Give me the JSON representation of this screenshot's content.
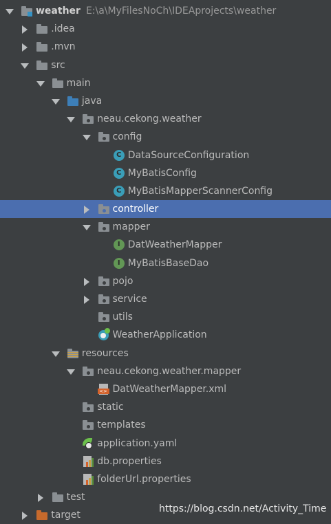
{
  "project": {
    "name": "weather",
    "path": "E:\\a\\MyFilesNoCh\\IDEAprojects\\weather"
  },
  "tree": [
    {
      "level": 0,
      "arrow": "down",
      "icon": "module-folder-icon",
      "label": "weather",
      "bold": true,
      "path": "E:\\a\\MyFilesNoCh\\IDEAprojects\\weather"
    },
    {
      "level": 1,
      "arrow": "right",
      "icon": "folder-icon",
      "label": ".idea"
    },
    {
      "level": 1,
      "arrow": "right",
      "icon": "folder-icon",
      "label": ".mvn"
    },
    {
      "level": 1,
      "arrow": "down",
      "icon": "folder-icon",
      "label": "src"
    },
    {
      "level": 2,
      "arrow": "down",
      "icon": "folder-icon",
      "label": "main"
    },
    {
      "level": 3,
      "arrow": "down",
      "icon": "source-folder-icon",
      "label": "java"
    },
    {
      "level": 4,
      "arrow": "down",
      "icon": "package-icon",
      "label": "neau.cekong.weather"
    },
    {
      "level": 5,
      "arrow": "down",
      "icon": "package-icon",
      "label": "config"
    },
    {
      "level": 6,
      "arrow": "none",
      "icon": "class-icon",
      "label": "DataSourceConfiguration"
    },
    {
      "level": 6,
      "arrow": "none",
      "icon": "class-icon",
      "label": "MyBatisConfig"
    },
    {
      "level": 6,
      "arrow": "none",
      "icon": "class-icon",
      "label": "MyBatisMapperScannerConfig"
    },
    {
      "level": 5,
      "arrow": "right",
      "icon": "package-icon",
      "label": "controller",
      "selected": true
    },
    {
      "level": 5,
      "arrow": "down",
      "icon": "package-icon",
      "label": "mapper"
    },
    {
      "level": 6,
      "arrow": "none",
      "icon": "interface-icon",
      "label": "DatWeatherMapper"
    },
    {
      "level": 6,
      "arrow": "none",
      "icon": "interface-icon",
      "label": "MyBatisBaseDao"
    },
    {
      "level": 5,
      "arrow": "right",
      "icon": "package-icon",
      "label": "pojo"
    },
    {
      "level": 5,
      "arrow": "right",
      "icon": "package-icon",
      "label": "service"
    },
    {
      "level": 5,
      "arrow": "none",
      "icon": "package-icon",
      "label": "utils"
    },
    {
      "level": 5,
      "arrow": "none",
      "icon": "spring-boot-app-icon",
      "label": "WeatherApplication"
    },
    {
      "level": 3,
      "arrow": "down",
      "icon": "resources-folder-icon",
      "label": "resources"
    },
    {
      "level": 4,
      "arrow": "down",
      "icon": "package-icon",
      "label": "neau.cekong.weather.mapper"
    },
    {
      "level": 5,
      "arrow": "none",
      "icon": "xml-file-icon",
      "label": "DatWeatherMapper.xml"
    },
    {
      "level": 4,
      "arrow": "none",
      "icon": "package-icon",
      "label": "static"
    },
    {
      "level": 4,
      "arrow": "none",
      "icon": "package-icon",
      "label": "templates"
    },
    {
      "level": 4,
      "arrow": "none",
      "icon": "yaml-file-icon",
      "label": "application.yaml"
    },
    {
      "level": 4,
      "arrow": "none",
      "icon": "properties-file-icon",
      "label": "db.properties"
    },
    {
      "level": 4,
      "arrow": "none",
      "icon": "properties-file-icon",
      "label": "folderUrl.properties"
    },
    {
      "level": 2,
      "arrow": "right",
      "icon": "folder-icon",
      "label": "test"
    },
    {
      "level": 1,
      "arrow": "right",
      "icon": "excluded-folder-icon",
      "label": "target"
    }
  ],
  "watermark": "https://blog.csdn.net/Activity_Time",
  "colors": {
    "background": "#3c3f41",
    "selection": "#4b6eaf",
    "text": "#bbbbbb"
  }
}
